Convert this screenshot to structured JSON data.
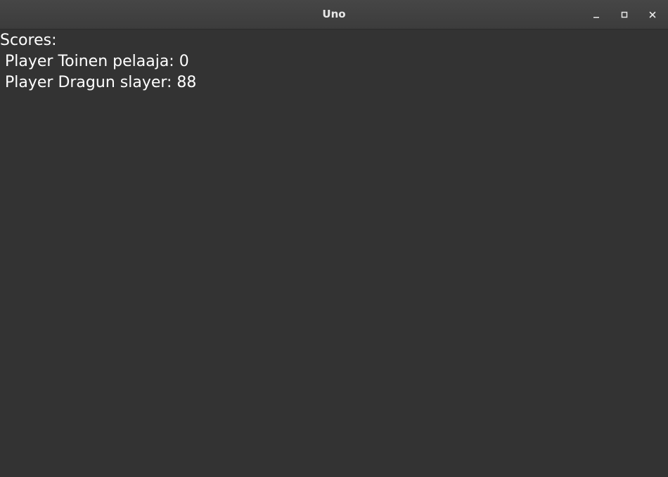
{
  "window": {
    "title": "Uno",
    "controls": {
      "minimize_icon": "minimize-icon",
      "maximize_icon": "maximize-icon",
      "close_icon": "close-icon"
    }
  },
  "scores": {
    "heading": "Scores:",
    "lines": [
      " Player Toinen pelaaja: 0",
      " Player Dragun slayer: 88"
    ],
    "players": [
      {
        "name": "Toinen pelaaja",
        "score": 0
      },
      {
        "name": "Dragun slayer",
        "score": 88
      }
    ]
  },
  "colors": {
    "background": "#333333",
    "titlebar": "#424242",
    "text": "#ffffff"
  }
}
